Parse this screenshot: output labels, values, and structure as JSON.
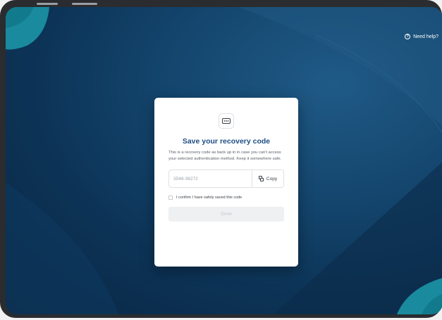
{
  "help": {
    "label": "Need help?",
    "icon": "question-circle-icon"
  },
  "dialog": {
    "icon": "password-dots-icon",
    "title": "Save your recovery code",
    "description": "This is a recovery code as back up in in case you can't access your selected authentication method. Keep it somewhere safe.",
    "code_value": "3546-36272",
    "copy_label": "Copy",
    "copy_icon": "copy-icon",
    "confirm_label": "I confirm I have safely saved this code",
    "confirm_checked": false,
    "done_label": "Done",
    "done_enabled": false
  },
  "colors": {
    "title": "#1d4e84",
    "background_dark": "#0a2643",
    "background_light": "#1f5a86",
    "accent_teal": "#1a8a9e"
  }
}
